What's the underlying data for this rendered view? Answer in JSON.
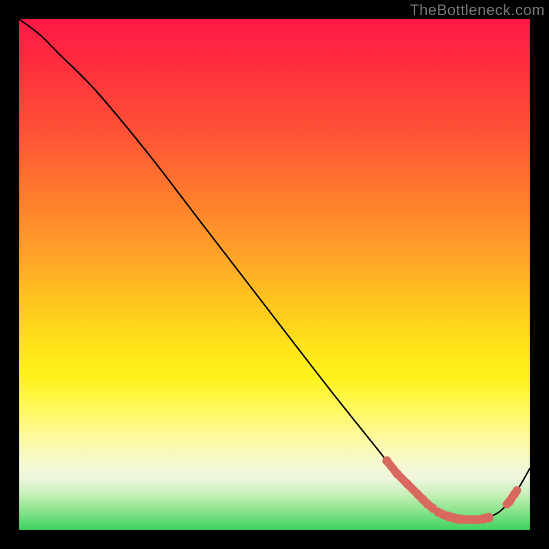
{
  "watermark": "TheBottleneck.com",
  "colors": {
    "background": "#000000",
    "gradient_top": "#ff1846",
    "gradient_mid": "#ffe31a",
    "gradient_bottom": "#3fd35f",
    "curve": "#000000",
    "marker": "#d9695e"
  },
  "chart_data": {
    "type": "line",
    "title": "",
    "xlabel": "",
    "ylabel": "",
    "xlim": [
      0,
      100
    ],
    "ylim": [
      0,
      100
    ],
    "grid": false,
    "series": [
      {
        "name": "curve",
        "x": [
          0,
          4,
          8,
          15,
          25,
          35,
          45,
          55,
          62,
          70,
          74,
          78,
          80,
          82,
          84,
          86,
          88,
          90,
          92,
          94,
          96,
          98,
          100
        ],
        "y": [
          100,
          97,
          93,
          86,
          74,
          61,
          48,
          35,
          26,
          16,
          11,
          7,
          5,
          3.5,
          2.5,
          2,
          2,
          2,
          2.5,
          3.5,
          5.5,
          8.5,
          12
        ]
      }
    ],
    "markers": [
      {
        "x": 72,
        "y": 13.5
      },
      {
        "x": 74,
        "y": 11
      },
      {
        "x": 76,
        "y": 9
      },
      {
        "x": 78,
        "y": 7
      },
      {
        "x": 79,
        "y": 6
      },
      {
        "x": 80,
        "y": 5
      },
      {
        "x": 81,
        "y": 4.2
      },
      {
        "x": 82,
        "y": 3.5
      },
      {
        "x": 83,
        "y": 3
      },
      {
        "x": 84,
        "y": 2.7
      },
      {
        "x": 85,
        "y": 2.4
      },
      {
        "x": 86,
        "y": 2.2
      },
      {
        "x": 87,
        "y": 2.1
      },
      {
        "x": 88,
        "y": 2
      },
      {
        "x": 89,
        "y": 2
      },
      {
        "x": 90,
        "y": 2
      },
      {
        "x": 91,
        "y": 2.1
      },
      {
        "x": 92,
        "y": 2.3
      },
      {
        "x": 96,
        "y": 5.5
      },
      {
        "x": 97,
        "y": 7
      }
    ],
    "highlight_segments": [
      {
        "x0": 72,
        "x1": 81
      },
      {
        "x0": 82,
        "x1": 92
      },
      {
        "x0": 95.5,
        "x1": 97.5
      }
    ]
  }
}
